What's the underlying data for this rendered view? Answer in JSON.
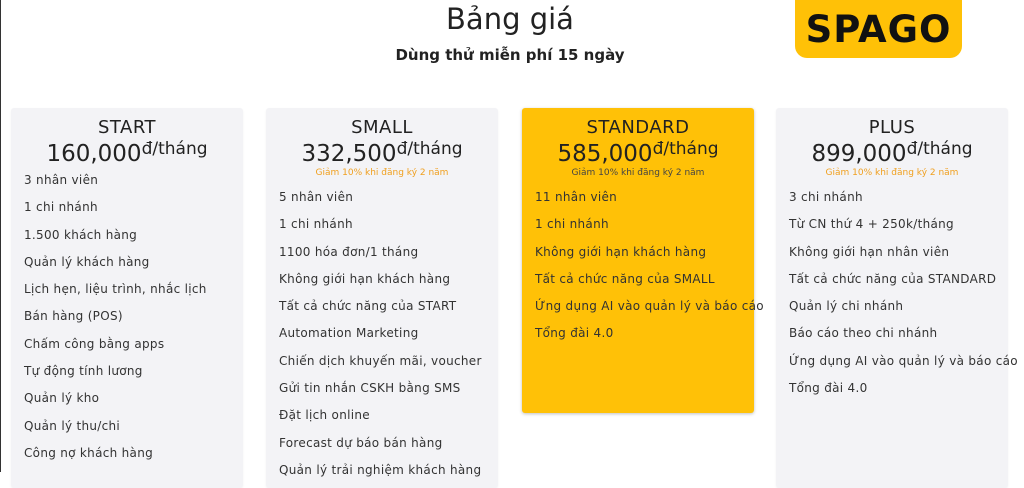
{
  "header": {
    "title": "Bảng giá",
    "subtitle": "Dùng thử miễn phí 15 ngày",
    "logo_text": "SPAGO",
    "accent_color": "#ffc107"
  },
  "plans": [
    {
      "name": "START",
      "price": "160,000",
      "unit": "đ/tháng",
      "discount": "",
      "features": [
        "3 nhân viên",
        "1 chi nhánh",
        "1.500 khách hàng",
        "Quản lý khách hàng",
        "Lịch hẹn, liệu trình, nhắc lịch",
        "Bán hàng (POS)",
        "Chấm công bằng apps",
        "Tự động tính lương",
        "Quản lý kho",
        "Quản lý thu/chi",
        "Công nợ khách hàng"
      ]
    },
    {
      "name": "SMALL",
      "price": "332,500",
      "unit": "đ/tháng",
      "discount": "Giảm 10% khi đăng ký 2 năm",
      "features": [
        "5 nhân viên",
        "1 chi nhánh",
        "1100 hóa đơn/1 tháng",
        "Không giới hạn khách hàng",
        "Tất cả chức năng của START",
        "Automation Marketing",
        "Chiến dịch khuyến mãi, voucher",
        "Gửi tin nhắn CSKH bằng SMS",
        "Đặt lịch online",
        "Forecast dự báo bán hàng",
        "Quản lý trải nghiệm khách hàng"
      ]
    },
    {
      "name": "STANDARD",
      "price": "585,000",
      "unit": "đ/tháng",
      "discount": "Giảm 10% khi đăng ký 2 năm",
      "features": [
        "11 nhân viên",
        "1 chi nhánh",
        "Không giới hạn khách hàng",
        "Tất cả chức năng của SMALL",
        "Ứng dụng AI vào quản lý và báo cáo",
        "Tổng đài 4.0"
      ]
    },
    {
      "name": "PLUS",
      "price": "899,000",
      "unit": "đ/tháng",
      "discount": "Giảm 10% khi đăng ký 2 năm",
      "features": [
        "3 chi nhánh",
        "Từ CN thứ 4 + 250k/tháng",
        "Không giới hạn nhân viên",
        "Tất cả chức năng của STANDARD",
        "Quản lý chi nhánh",
        "Báo cáo theo chi nhánh",
        "Ứng dụng AI vào quản lý và báo cáo",
        "Tổng đài 4.0"
      ]
    }
  ]
}
